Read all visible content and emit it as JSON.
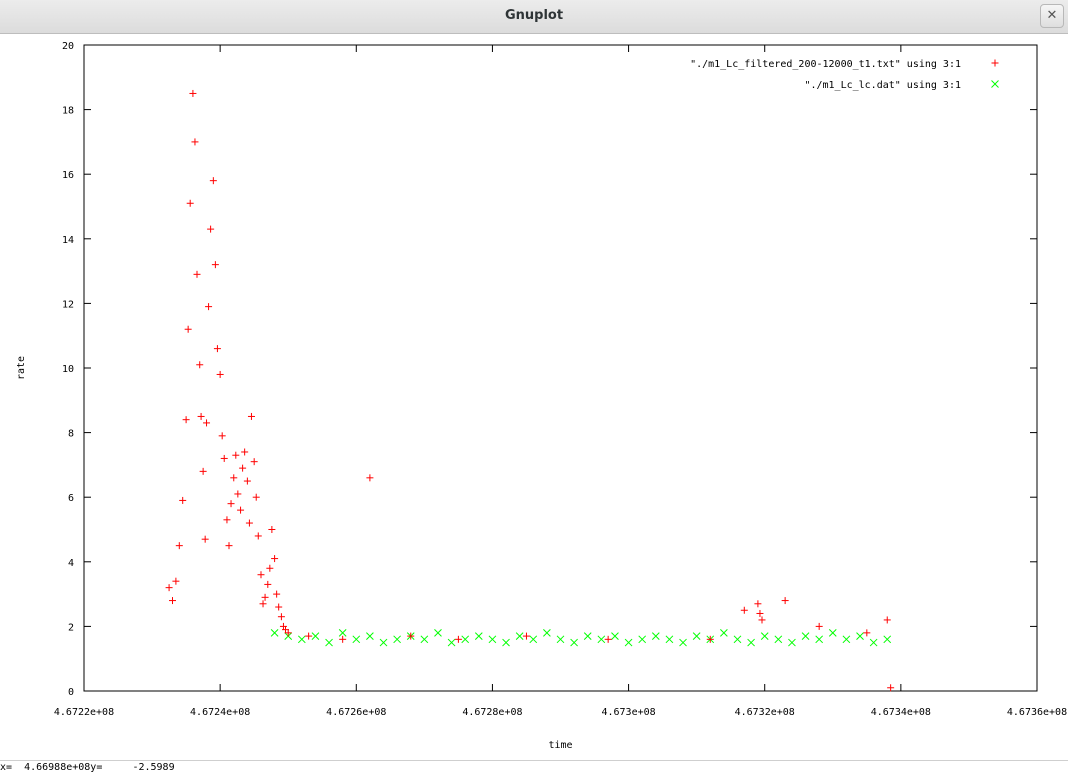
{
  "window": {
    "title": "Gnuplot",
    "close_icon": "close-icon"
  },
  "status": {
    "text": "x=  4.66988e+08y=     -2.5989"
  },
  "chart_data": {
    "type": "scatter",
    "xlabel": "time",
    "ylabel": "rate",
    "xlim": [
      467220000,
      467360000
    ],
    "ylim": [
      0,
      20
    ],
    "xticks": [
      467220000,
      467240000,
      467260000,
      467280000,
      467300000,
      467320000,
      467340000,
      467360000
    ],
    "xtick_labels": [
      "4.6722e+08",
      "4.6724e+08",
      "4.6726e+08",
      "4.6728e+08",
      "4.673e+08",
      "4.6732e+08",
      "4.6734e+08",
      "4.6736e+08"
    ],
    "yticks": [
      0,
      2,
      4,
      6,
      8,
      10,
      12,
      14,
      16,
      18,
      20
    ],
    "ytick_labels": [
      "0",
      "2",
      "4",
      "6",
      "8",
      "10",
      "12",
      "14",
      "16",
      "18",
      "20"
    ],
    "legend_position": "top-right",
    "grid": false,
    "series": [
      {
        "name": "\"./m1_Lc_filtered_200-12000_t1.txt\" using 3:1",
        "marker": "+",
        "color": "#ff0000",
        "x": [
          467232500,
          467233000,
          467233500,
          467234000,
          467234500,
          467235000,
          467235300,
          467235600,
          467236000,
          467236300,
          467236600,
          467237000,
          467237200,
          467237500,
          467237800,
          467238000,
          467238300,
          467238600,
          467239000,
          467239300,
          467239600,
          467240000,
          467240300,
          467240600,
          467241000,
          467241300,
          467241600,
          467242000,
          467242300,
          467242600,
          467243000,
          467243300,
          467243600,
          467244000,
          467244300,
          467244600,
          467245000,
          467245300,
          467245600,
          467246000,
          467246300,
          467246600,
          467247000,
          467247300,
          467247600,
          467248000,
          467248300,
          467248600,
          467249000,
          467249300,
          467249600,
          467250000,
          467253000,
          467258000,
          467262000,
          467268000,
          467275000,
          467285000,
          467297000,
          467312000,
          467317000,
          467319000,
          467319300,
          467319600,
          467323000,
          467328000,
          467335000,
          467338000,
          467338500
        ],
        "y": [
          3.2,
          2.8,
          3.4,
          4.5,
          5.9,
          8.4,
          11.2,
          15.1,
          18.5,
          17.0,
          12.9,
          10.1,
          8.5,
          6.8,
          4.7,
          8.3,
          11.9,
          14.3,
          15.8,
          13.2,
          10.6,
          9.8,
          7.9,
          7.2,
          5.3,
          4.5,
          5.8,
          6.6,
          7.3,
          6.1,
          5.6,
          6.9,
          7.4,
          6.5,
          5.2,
          8.5,
          7.1,
          6.0,
          4.8,
          3.6,
          2.7,
          2.9,
          3.3,
          3.8,
          5.0,
          4.1,
          3.0,
          2.6,
          2.3,
          2.0,
          1.9,
          1.8,
          1.7,
          1.6,
          6.6,
          1.7,
          1.6,
          1.7,
          1.6,
          1.6,
          2.5,
          2.7,
          2.4,
          2.2,
          2.8,
          2.0,
          1.8,
          2.2,
          0.1
        ]
      },
      {
        "name": "\"./m1_Lc_lc.dat\" using 3:1",
        "marker": "x",
        "color": "#00ff00",
        "x": [
          467248000,
          467250000,
          467252000,
          467254000,
          467256000,
          467258000,
          467260000,
          467262000,
          467264000,
          467266000,
          467268000,
          467270000,
          467272000,
          467274000,
          467276000,
          467278000,
          467280000,
          467282000,
          467284000,
          467286000,
          467288000,
          467290000,
          467292000,
          467294000,
          467296000,
          467298000,
          467300000,
          467302000,
          467304000,
          467306000,
          467308000,
          467310000,
          467312000,
          467314000,
          467316000,
          467318000,
          467320000,
          467322000,
          467324000,
          467326000,
          467328000,
          467330000,
          467332000,
          467334000,
          467336000,
          467338000
        ],
        "y": [
          1.8,
          1.7,
          1.6,
          1.7,
          1.5,
          1.8,
          1.6,
          1.7,
          1.5,
          1.6,
          1.7,
          1.6,
          1.8,
          1.5,
          1.6,
          1.7,
          1.6,
          1.5,
          1.7,
          1.6,
          1.8,
          1.6,
          1.5,
          1.7,
          1.6,
          1.7,
          1.5,
          1.6,
          1.7,
          1.6,
          1.5,
          1.7,
          1.6,
          1.8,
          1.6,
          1.5,
          1.7,
          1.6,
          1.5,
          1.7,
          1.6,
          1.8,
          1.6,
          1.7,
          1.5,
          1.6
        ]
      }
    ]
  }
}
